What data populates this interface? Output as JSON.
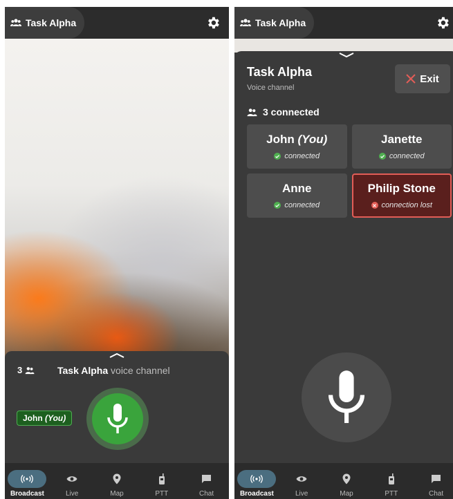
{
  "left": {
    "title": "Task Alpha",
    "voice": {
      "count": "3",
      "channel_name": "Task Alpha",
      "channel_suffix": "voice channel",
      "speaker_name": "John",
      "speaker_you": "(You)"
    }
  },
  "right": {
    "title": "Task Alpha",
    "panel": {
      "title": "Task Alpha",
      "subtitle": "Voice channel",
      "exit_label": "Exit",
      "connected_text": "3 connected"
    },
    "participants": [
      {
        "name": "John",
        "you": "(You)",
        "status": "connected"
      },
      {
        "name": "Janette",
        "you": "",
        "status": "connected"
      },
      {
        "name": "Anne",
        "you": "",
        "status": "connected"
      },
      {
        "name": "Philip Stone",
        "you": "",
        "status": "connection lost"
      }
    ]
  },
  "nav": [
    {
      "label": "Broadcast",
      "icon": "broadcast-icon",
      "active": true
    },
    {
      "label": "Live",
      "icon": "eye-icon",
      "active": false
    },
    {
      "label": "Map",
      "icon": "map-pin-icon",
      "active": false
    },
    {
      "label": "PTT",
      "icon": "walkie-talkie-icon",
      "active": false
    },
    {
      "label": "Chat",
      "icon": "chat-icon",
      "active": false
    }
  ],
  "colors": {
    "status_ok": "#4fb050",
    "status_lost": "#e35d57",
    "mic_active": "#3aa43c",
    "nav_active": "#4b6e80"
  }
}
